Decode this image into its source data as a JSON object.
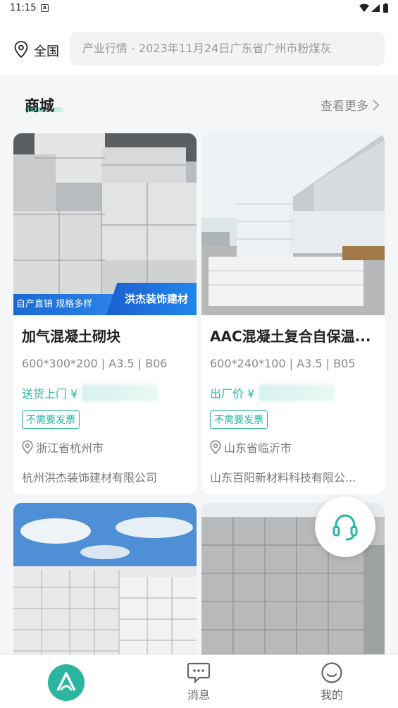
{
  "status_bar": {
    "time": "11:15",
    "notification_letter": "A"
  },
  "header": {
    "location_label": "全国",
    "search_placeholder": "产业行情 - 2023年11月24日广东省广州市粉煤灰"
  },
  "section": {
    "title": "商城",
    "more_label": "查看更多"
  },
  "products": [
    {
      "title": "加气混凝土砌块",
      "spec": "600*300*200 | A3.5 | B06",
      "price_label": "送货上门 ¥",
      "tag": "不需要发票",
      "location": "浙江省杭州市",
      "company": "杭州洪杰装饰建材有限公司",
      "banner_left": "自产直销 规格多样",
      "banner_right": "洪杰装饰建材"
    },
    {
      "title": "AAC混凝土复合自保温...",
      "spec": "600*240*100 | A3.5 | B05",
      "price_label": "出厂价 ¥",
      "tag": "不需要发票",
      "location": "山东省临沂市",
      "company": "山东百阳新材料科技有限公..."
    }
  ],
  "tabbar": {
    "items": [
      {
        "label": ""
      },
      {
        "label": "消息"
      },
      {
        "label": "我的"
      }
    ]
  },
  "colors": {
    "accent": "#2bb5a0",
    "banner_blue": "#1c6fd8"
  },
  "icons": {
    "location": "location-pin-icon",
    "chevron": "chevron-right-icon",
    "support": "headset-icon",
    "home": "home-logo-icon",
    "messages": "chat-bubble-icon",
    "profile": "smiley-face-icon"
  }
}
